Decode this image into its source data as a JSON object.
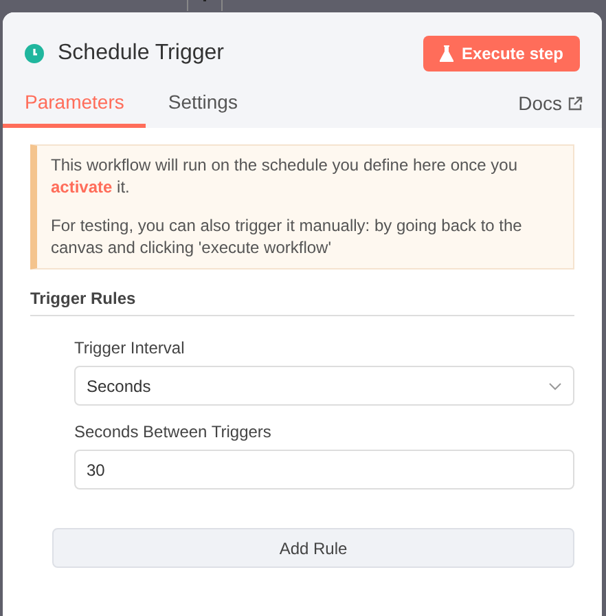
{
  "node": {
    "title": "Schedule Trigger",
    "execute_button": "Execute step"
  },
  "tabs": [
    {
      "label": "Parameters",
      "selected": true
    },
    {
      "label": "Settings",
      "selected": false
    }
  ],
  "docs_link": "Docs",
  "notice": {
    "paragraphs": [
      "This workflow will run on the schedule you define here once you **activate** it.",
      "For testing, you can also trigger it manually: by going back to the canvas and clicking 'execute workflow'"
    ]
  },
  "section_title": "Trigger Rules",
  "fields": [
    {
      "kind": "select",
      "label": "Trigger Interval",
      "value": "Seconds"
    },
    {
      "kind": "input",
      "label": "Seconds Between Triggers",
      "value": "30"
    }
  ],
  "add_button": "Add Rule"
}
